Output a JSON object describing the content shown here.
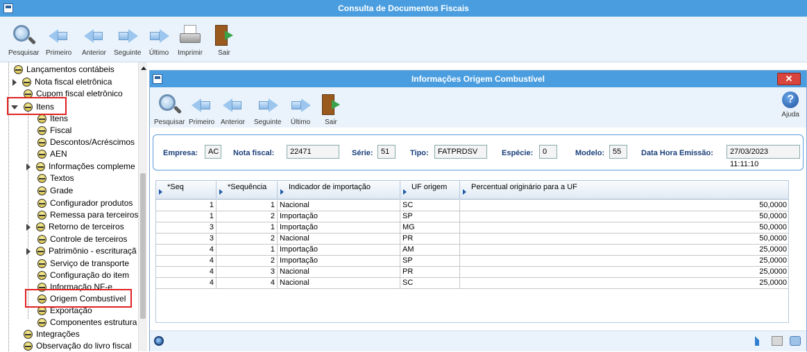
{
  "app": {
    "title": "Consulta de Documentos Fiscais"
  },
  "main_toolbar": {
    "buttons": [
      {
        "label": "Pesquisar",
        "icon": "search-icon"
      },
      {
        "label": "Primeiro",
        "icon": "first-icon"
      },
      {
        "label": "Anterior",
        "icon": "previous-icon"
      },
      {
        "label": "Seguinte",
        "icon": "next-icon"
      },
      {
        "label": "Último",
        "icon": "last-icon"
      },
      {
        "label": "Imprimir",
        "icon": "print-icon"
      },
      {
        "label": "Sair",
        "icon": "exit-icon"
      }
    ]
  },
  "tree": {
    "items": [
      {
        "label": "Lançamentos contábeis"
      },
      {
        "label": "Nota fiscal eletrônica"
      },
      {
        "label": "Cupom fiscal eletrônico"
      },
      {
        "label": "Itens"
      },
      {
        "label": "Itens"
      },
      {
        "label": "Fiscal"
      },
      {
        "label": "Descontos/Acréscimos"
      },
      {
        "label": "AEN"
      },
      {
        "label": "Informações compleme"
      },
      {
        "label": "Textos"
      },
      {
        "label": "Grade"
      },
      {
        "label": "Configurador produtos"
      },
      {
        "label": "Remessa para terceiros"
      },
      {
        "label": "Retorno de terceiros"
      },
      {
        "label": "Controle de terceiros"
      },
      {
        "label": "Patrimônio - escrituraçã"
      },
      {
        "label": "Serviço de transporte"
      },
      {
        "label": "Configuração do item"
      },
      {
        "label": "Informação NF-e"
      },
      {
        "label": "Origem Combustível"
      },
      {
        "label": "Exportação"
      },
      {
        "label": "Componentes estrutura"
      },
      {
        "label": "Integrações"
      },
      {
        "label": "Observação do livro fiscal"
      }
    ]
  },
  "dialog": {
    "title": "Informações Origem Combustível",
    "close_label": "✕",
    "toolbar": {
      "buttons": [
        {
          "label": "Pesquisar"
        },
        {
          "label": "Primeiro"
        },
        {
          "label": "Anterior"
        },
        {
          "label": "Seguinte"
        },
        {
          "label": "Último"
        },
        {
          "label": "Sair"
        }
      ],
      "help_label": "Ajuda"
    },
    "header": {
      "empresa_label": "Empresa:",
      "empresa_value": "AC",
      "nota_label": "Nota fiscal:",
      "nota_value": "22471",
      "serie_label": "Série:",
      "serie_value": "51",
      "tipo_label": "Tipo:",
      "tipo_value": "FATPRDSV",
      "especie_label": "Espécie:",
      "especie_value": "0",
      "modelo_label": "Modelo:",
      "modelo_value": "55",
      "data_label": "Data Hora Emissão:",
      "data_value": "27/03/2023 11:11:10"
    },
    "grid": {
      "columns": [
        "*Seq",
        "*Sequência",
        "Indicador de importação",
        "UF origem",
        "Percentual originário para a UF"
      ],
      "rows": [
        [
          "1",
          "1",
          "Nacional",
          "SC",
          "50,0000"
        ],
        [
          "1",
          "2",
          "Importação",
          "SP",
          "50,0000"
        ],
        [
          "3",
          "1",
          "Importação",
          "MG",
          "50,0000"
        ],
        [
          "3",
          "2",
          "Nacional",
          "PR",
          "50,0000"
        ],
        [
          "4",
          "1",
          "Importação",
          "AM",
          "25,0000"
        ],
        [
          "4",
          "2",
          "Importação",
          "SP",
          "25,0000"
        ],
        [
          "4",
          "3",
          "Nacional",
          "PR",
          "25,0000"
        ],
        [
          "4",
          "4",
          "Nacional",
          "SC",
          "25,0000"
        ]
      ]
    }
  }
}
